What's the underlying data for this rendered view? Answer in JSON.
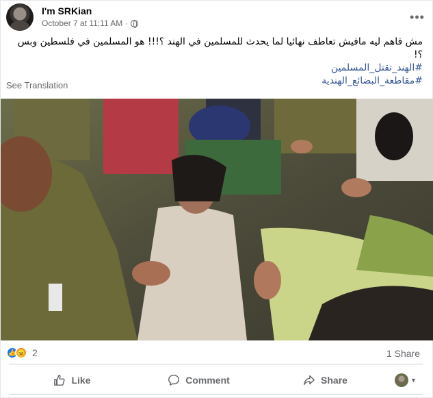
{
  "post": {
    "author": "I'm SRKian",
    "timestamp": "October 7 at 11:11 AM",
    "separator": "·",
    "more_icon": "more-horizontal-icon",
    "text_line_1": "مش فاهم ليه مافيش تعاطف نهائيا لما يحدث للمسلمين في الهند ؟!!! هو المسلمين في فلسطين وبس ؟!",
    "hashtag_1": "#الهند_تقتل_المسلمين",
    "hashtag_2": "#مقاطعة_البضائع_الهندية",
    "see_translation": "See Translation"
  },
  "stats": {
    "reactions": [
      "like",
      "angry"
    ],
    "reaction_count": "2",
    "shares": "1 Share"
  },
  "actions": {
    "like": "Like",
    "comment": "Comment",
    "share": "Share"
  },
  "colors": {
    "link": "#385898",
    "secondary_text": "#65676b",
    "like_blue": "#1877f2"
  }
}
